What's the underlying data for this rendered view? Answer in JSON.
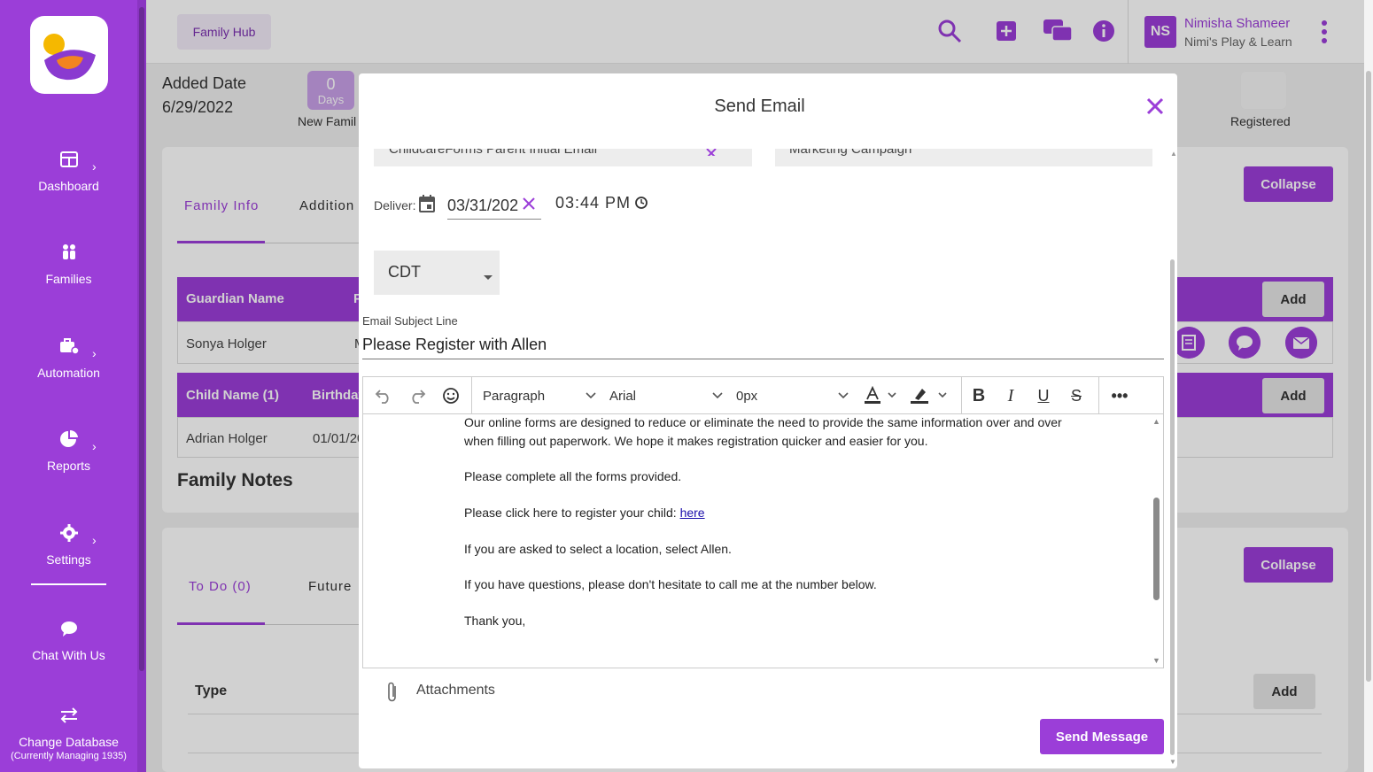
{
  "sidebar": {
    "items": [
      {
        "label": "Dashboard"
      },
      {
        "label": "Families"
      },
      {
        "label": "Automation"
      },
      {
        "label": "Reports"
      },
      {
        "label": "Settings"
      },
      {
        "label": "Chat With Us"
      },
      {
        "label": "Change Database",
        "sub": "(Currently Managing 1935)"
      }
    ]
  },
  "header": {
    "hub_label": "Family Hub",
    "user_initials": "NS",
    "user_name": "Nimisha Shameer",
    "user_org": "Nimi's Play & Learn"
  },
  "family": {
    "added_label": "Added Date",
    "added_date": "6/29/2022",
    "days_count": "0",
    "days_unit": "Days",
    "new_family": "New Famil",
    "registered": "Registered"
  },
  "family_card": {
    "tabs": [
      "Family Info",
      "Addition"
    ],
    "collapse_label": "Collapse",
    "guardian_header": "Guardian Name",
    "guardian_header2": "P",
    "guardian_row": [
      "Sonya Holger",
      "M"
    ],
    "child_header": "Child Name (1)",
    "child_header2": "Birthdat",
    "child_row": [
      "Adrian Holger",
      "01/01/20"
    ],
    "add_label": "Add",
    "notes_title": "Family Notes"
  },
  "todo_card": {
    "tabs": [
      "To Do (0)",
      "Future"
    ],
    "collapse_label": "Collapse",
    "type_label": "Type",
    "add_label": "Add"
  },
  "modal": {
    "title": "Send Email",
    "template_value": "ChildcareForms Parent Initial Email",
    "campaign_value": "Marketing Campaign",
    "deliver_label": "Deliver:",
    "date_value": "03/31/202",
    "time_value": "03:44 PM",
    "timezone": "CDT",
    "subject_label": "Email Subject Line",
    "subject_value": "Please Register with Allen",
    "toolbar": {
      "block_format": "Paragraph",
      "font_family": "Arial",
      "font_size": "0px"
    },
    "body": {
      "p1": "Our online forms are designed to reduce or eliminate the need to provide the same information over and over when filling out paperwork. We hope it makes registration quicker and easier for you.",
      "p2": "Please complete all the forms provided.",
      "p3_prefix": "Please click here to register your child: ",
      "p3_link": "here",
      "p4": "If you are asked to select a location, select Allen.",
      "p5": "If you have questions, please don't hesitate to call me at the number below.",
      "p6": "Thank you,"
    },
    "attachments_label": "Attachments",
    "send_label": "Send Message"
  },
  "colors": {
    "brand": "#9b3ed8",
    "link": "#1a0dab"
  }
}
